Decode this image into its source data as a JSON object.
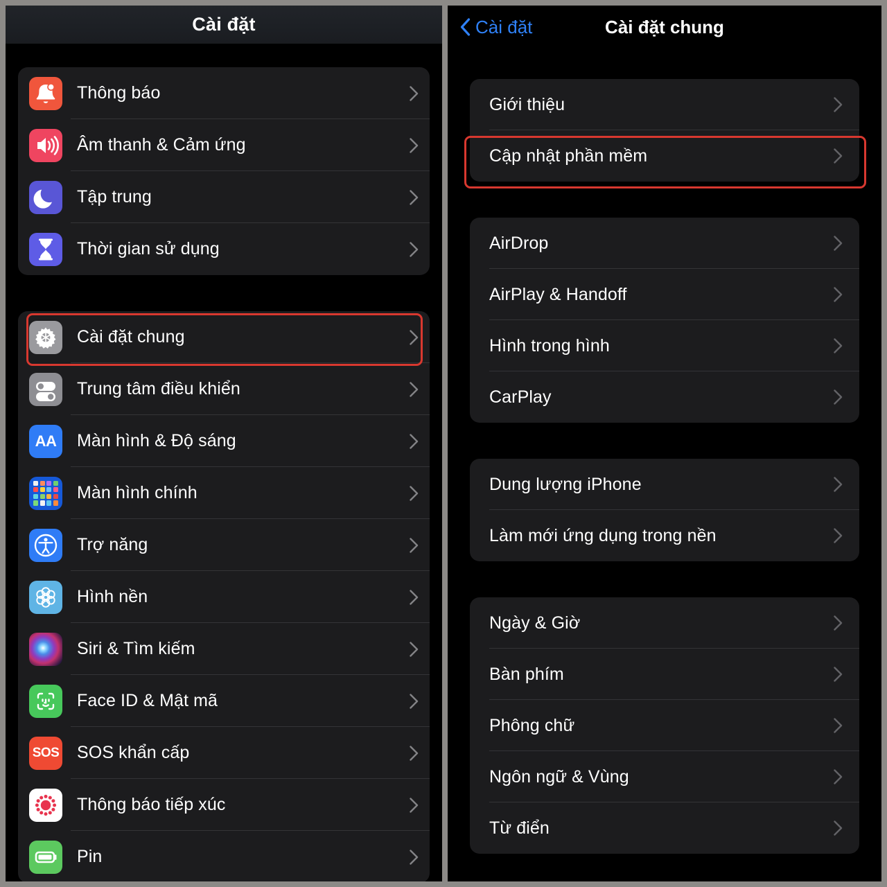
{
  "frame": {
    "bg_color": "#8c8a87",
    "highlight_color": "#d8382f"
  },
  "left_panel": {
    "navbar": {
      "title": "Cài đặt"
    },
    "groups": [
      {
        "items": [
          {
            "label": "Thông báo",
            "icon": "bell-icon",
            "icon_color": "#f0563c"
          },
          {
            "label": "Âm thanh & Cảm ứng",
            "icon": "speaker-icon",
            "icon_color": "#ef4560"
          },
          {
            "label": "Tập trung",
            "icon": "moon-icon",
            "icon_color": "#5956d6"
          },
          {
            "label": "Thời gian sử dụng",
            "icon": "hourglass-icon",
            "icon_color": "#5e5ce6"
          }
        ]
      },
      {
        "items": [
          {
            "label": "Cài đặt chung",
            "icon": "gear-icon",
            "icon_color": "#9a9a9e",
            "highlighted": true
          },
          {
            "label": "Trung tâm điều khiển",
            "icon": "sliders-icon",
            "icon_color": "#8e8e93"
          },
          {
            "label": "Màn hình & Độ sáng",
            "icon": "aa-icon",
            "icon_color": "#2f7cf6"
          },
          {
            "label": "Màn hình chính",
            "icon": "app-grid-icon",
            "icon_color": "#1659d8"
          },
          {
            "label": "Trợ năng",
            "icon": "accessibility-icon",
            "icon_color": "#2f7cf6"
          },
          {
            "label": "Hình nền",
            "icon": "wallpaper-icon",
            "icon_color": "#5fb4e5"
          },
          {
            "label": "Siri & Tìm kiếm",
            "icon": "siri-icon",
            "icon_color": "#8e3bbf"
          },
          {
            "label": "Face ID & Mật mã",
            "icon": "face-id-icon",
            "icon_color": "#47c85b"
          },
          {
            "label": "SOS khẩn cấp",
            "icon": "sos-icon",
            "icon_color": "#ef4a33"
          },
          {
            "label": "Thông báo tiếp xúc",
            "icon": "exposure-notification-icon",
            "icon_color": "#ffffff"
          },
          {
            "label": "Pin",
            "icon": "battery-icon",
            "icon_color": "#5cc95f"
          }
        ]
      }
    ]
  },
  "right_panel": {
    "navbar": {
      "back_label": "Cài đặt",
      "back_icon": "chevron-left-icon",
      "title": "Cài đặt chung"
    },
    "groups": [
      {
        "items": [
          {
            "label": "Giới thiệu"
          },
          {
            "label": "Cập nhật phần mềm",
            "highlighted": true
          }
        ]
      },
      {
        "items": [
          {
            "label": "AirDrop"
          },
          {
            "label": "AirPlay & Handoff"
          },
          {
            "label": "Hình trong hình"
          },
          {
            "label": "CarPlay"
          }
        ]
      },
      {
        "items": [
          {
            "label": "Dung lượng iPhone"
          },
          {
            "label": "Làm mới ứng dụng trong nền"
          }
        ]
      },
      {
        "items": [
          {
            "label": "Ngày & Giờ"
          },
          {
            "label": "Bàn phím"
          },
          {
            "label": "Phông chữ"
          },
          {
            "label": "Ngôn ngữ & Vùng"
          },
          {
            "label": "Từ điển"
          }
        ]
      }
    ]
  }
}
